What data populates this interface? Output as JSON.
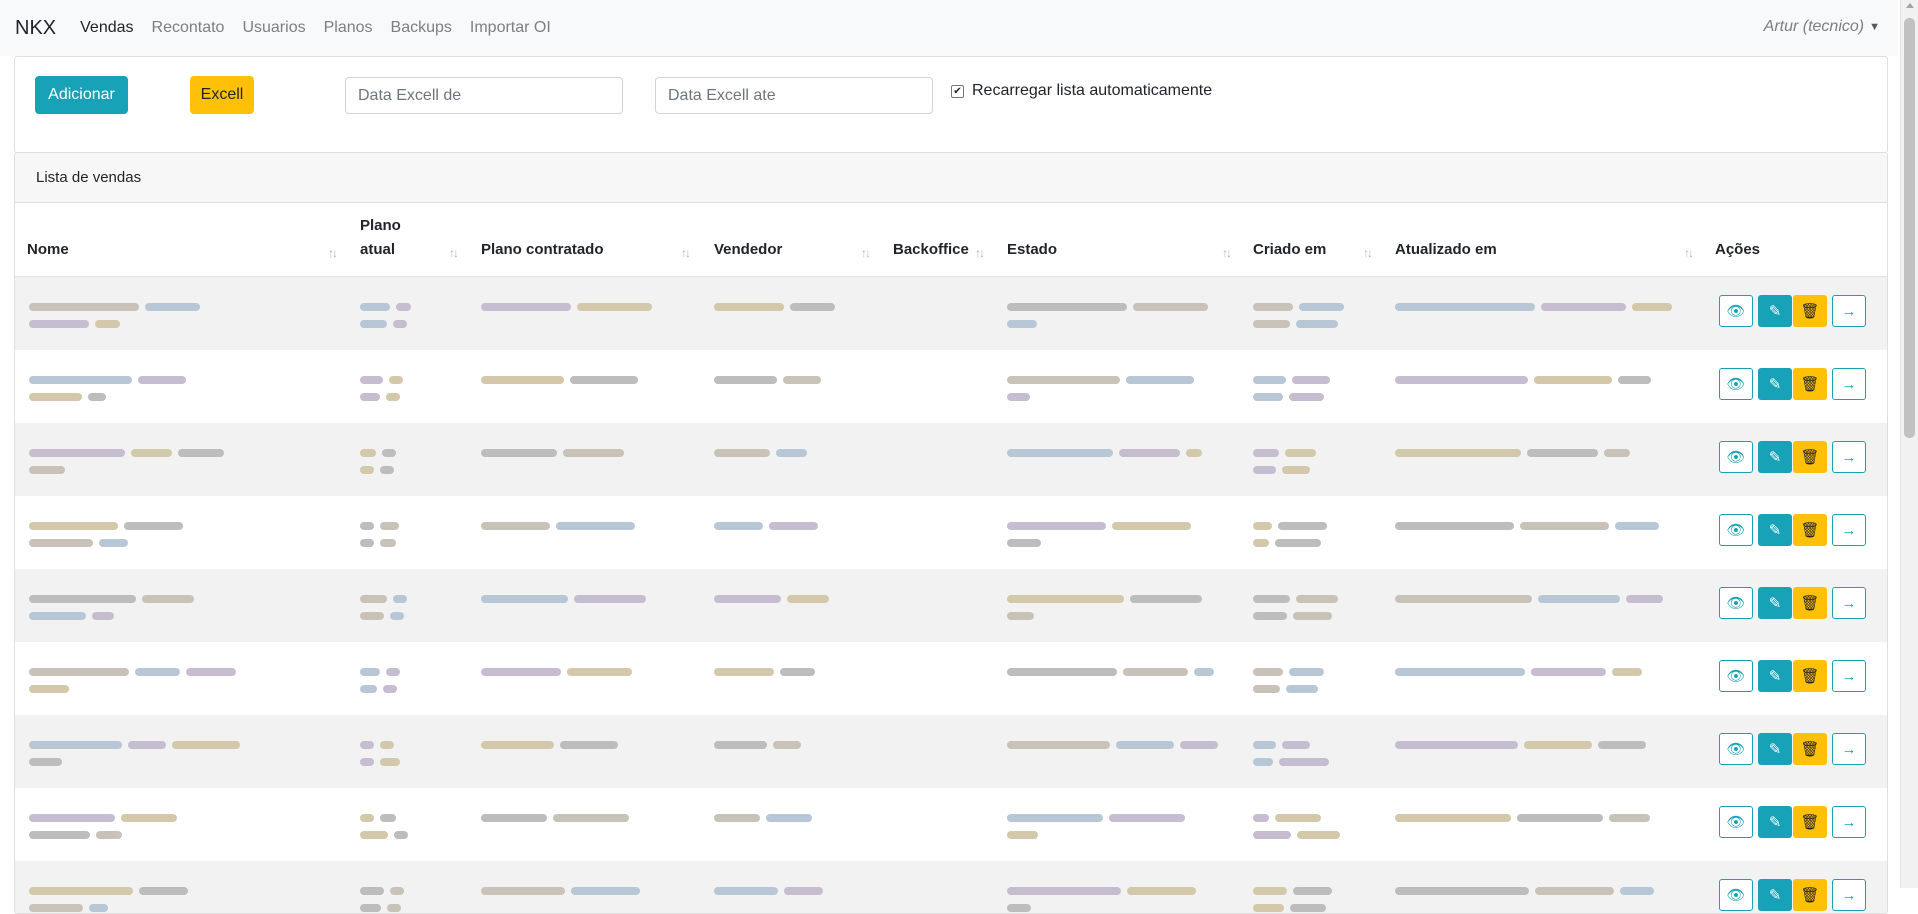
{
  "navbar": {
    "brand": "NKX",
    "items": [
      {
        "label": "Vendas",
        "active": true
      },
      {
        "label": "Recontato",
        "active": false
      },
      {
        "label": "Usuarios",
        "active": false
      },
      {
        "label": "Planos",
        "active": false
      },
      {
        "label": "Backups",
        "active": false
      },
      {
        "label": "Importar OI",
        "active": false
      }
    ],
    "user": "Artur (tecnico)"
  },
  "toolbar": {
    "add_label": "Adicionar",
    "excel_label": "Excell",
    "date_from_placeholder": "Data Excell de",
    "date_to_placeholder": "Data Excell ate",
    "auto_reload_label": "Recarregar lista automaticamente",
    "auto_reload_checked": true
  },
  "list": {
    "header": "Lista de vendas",
    "columns": [
      "Nome",
      "Plano atual",
      "Plano contratado",
      "Vendedor",
      "Backoffice",
      "Estado",
      "Criado em",
      "Atualizado em",
      "Ações"
    ],
    "row_count": 9,
    "rows_obscured": true
  },
  "colors": {
    "info": "#17a2b8",
    "warning": "#ffc107",
    "navbar_bg": "#f8f9fa",
    "stripe": "#f2f2f2"
  },
  "icons": {
    "view": "eye-icon",
    "edit": "edit-icon",
    "delete": "trash-icon",
    "open": "arrow-right-icon",
    "sort": "sort-arrows-icon",
    "user_menu": "caret-down-icon"
  }
}
